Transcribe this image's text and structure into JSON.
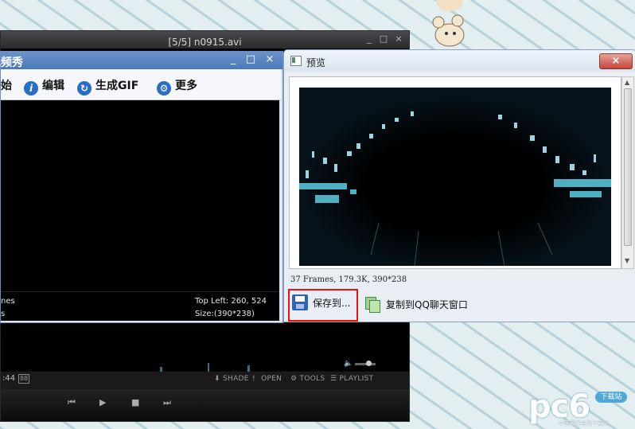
{
  "player": {
    "title": "[5/5] n0915.avi",
    "time": ":44",
    "badge": "88",
    "links": [
      "SHADE",
      "OPEN",
      "TOOLS",
      "PLAYLIST"
    ],
    "window_buttons": [
      "_",
      "□",
      "×"
    ]
  },
  "video_show": {
    "title": "视频秀",
    "toolbar": [
      {
        "label": "开始",
        "icon": "start-icon"
      },
      {
        "label": "编辑",
        "icon": "info-icon"
      },
      {
        "label": "生成GIF",
        "icon": "refresh-icon"
      },
      {
        "label": "更多",
        "icon": "gear-icon"
      }
    ],
    "status": {
      "frames_partial": "nes",
      "seconds_partial": "s",
      "top_left": "Top Left: 260, 524",
      "size": "Size:(390*238)"
    }
  },
  "preview": {
    "title": "预览",
    "close": "×",
    "info": "37 Frames, 179.3K, 390*238",
    "save_label": "保存到...",
    "copy_label": "复制到QQ聊天窗口"
  },
  "watermark": {
    "text": "pc6",
    "badge": "下载站",
    "slogan": "中国最安全的下载站"
  },
  "colors": {
    "accent_blue": "#4a78b8",
    "highlight_red": "#e11111",
    "close_red": "#c2453a"
  }
}
